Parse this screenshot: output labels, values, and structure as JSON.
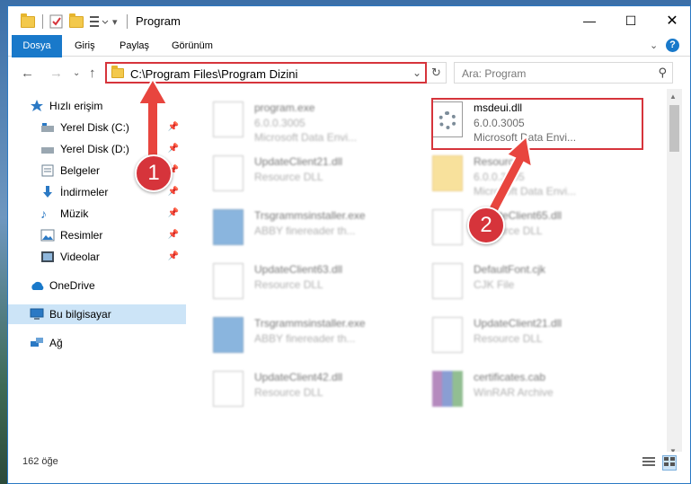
{
  "window": {
    "title": "Program"
  },
  "ribbon": {
    "tabs": [
      "Dosya",
      "Giriş",
      "Paylaş",
      "Görünüm"
    ]
  },
  "address": {
    "path": "C:\\Program Files\\Program Dizini"
  },
  "search": {
    "placeholder": "Ara: Program"
  },
  "nav": {
    "items": [
      {
        "label": "Hızlı erişim",
        "icon": "star-icon"
      },
      {
        "label": "Yerel Disk (C:)",
        "icon": "drive-icon",
        "pinned": true
      },
      {
        "label": "Yerel Disk (D:)",
        "icon": "drive-icon",
        "pinned": true
      },
      {
        "label": "Belgeler",
        "icon": "documents-icon",
        "pinned": true
      },
      {
        "label": "İndirmeler",
        "icon": "download-icon",
        "pinned": true
      },
      {
        "label": "Müzik",
        "icon": "music-icon",
        "pinned": true
      },
      {
        "label": "Resimler",
        "icon": "pictures-icon",
        "pinned": true
      },
      {
        "label": "Videolar",
        "icon": "video-icon",
        "pinned": true
      },
      {
        "label": "OneDrive",
        "icon": "cloud-icon"
      },
      {
        "label": "Bu bilgisayar",
        "icon": "computer-icon",
        "selected": true
      },
      {
        "label": "Ağ",
        "icon": "network-icon"
      }
    ]
  },
  "files": [
    {
      "name": "program.exe",
      "line2": "6.0.0.3005",
      "line3": "Microsoft Data Envi...",
      "icon": "exe-icon"
    },
    {
      "name": "msdeui.dll",
      "line2": "6.0.0.3005",
      "line3": "Microsoft Data Envi...",
      "icon": "dll-gear-icon"
    },
    {
      "name": "UpdateClient21.dll",
      "line2": "Resource DLL",
      "line3": "",
      "icon": "dll-icon"
    },
    {
      "name": "Resource",
      "line2": "6.0.0.3005",
      "line3": "Microsoft Data Envi...",
      "icon": "folder-file-icon"
    },
    {
      "name": "Trsgrammsinstaller.exe",
      "line2": "ABBY finereader th...",
      "line3": "",
      "icon": "installer-icon"
    },
    {
      "name": "UpdateClient65.dll",
      "line2": "Resource DLL",
      "line3": "",
      "icon": "dll-icon"
    },
    {
      "name": "UpdateClient63.dll",
      "line2": "Resource DLL",
      "line3": "",
      "icon": "dll-icon"
    },
    {
      "name": "DefaultFont.cjk",
      "line2": "CJK File",
      "line3": "",
      "icon": "file-icon"
    },
    {
      "name": "Trsgrammsinstaller.exe",
      "line2": "ABBY finereader th...",
      "line3": "",
      "icon": "installer-icon"
    },
    {
      "name": "UpdateClient21.dll",
      "line2": "Resource DLL",
      "line3": "",
      "icon": "dll-icon"
    },
    {
      "name": "UpdateClient42.dll",
      "line2": "Resource DLL",
      "line3": "",
      "icon": "dll-icon"
    },
    {
      "name": "certificates.cab",
      "line2": "WinRAR Archive",
      "line3": "",
      "icon": "archive-icon"
    }
  ],
  "status": {
    "count": "162 öğe"
  },
  "callouts": {
    "one": "1",
    "two": "2"
  },
  "colors": {
    "accent": "#1979ca",
    "highlight": "#d6343b",
    "selection": "#cce4f7"
  }
}
